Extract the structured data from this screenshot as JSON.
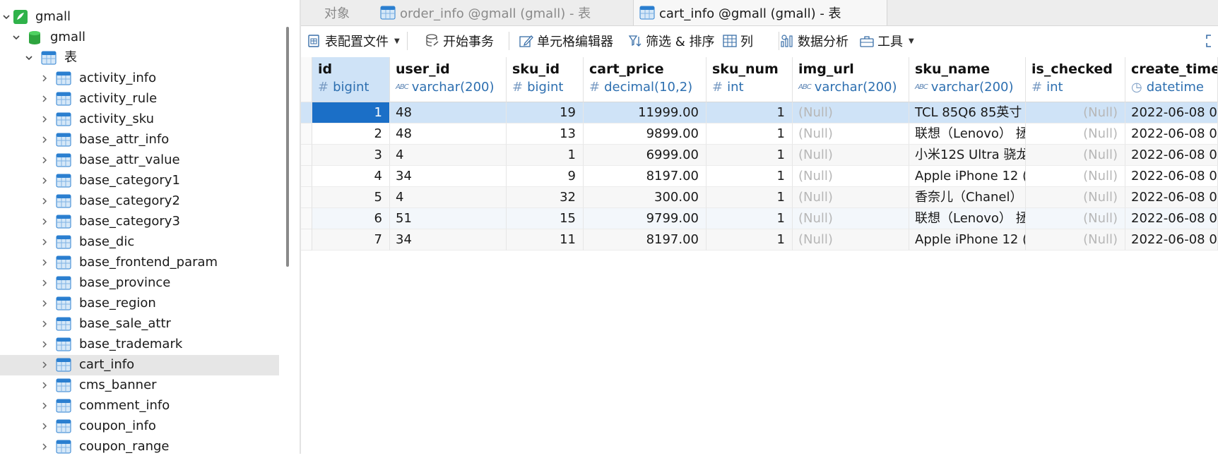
{
  "tree": {
    "root": "gmall",
    "database": "gmall",
    "tables_group": "表",
    "tables": [
      "activity_info",
      "activity_rule",
      "activity_sku",
      "base_attr_info",
      "base_attr_value",
      "base_category1",
      "base_category2",
      "base_category3",
      "base_dic",
      "base_frontend_param",
      "base_province",
      "base_region",
      "base_sale_attr",
      "base_trademark",
      "cart_info",
      "cms_banner",
      "comment_info",
      "coupon_info",
      "coupon_range"
    ],
    "selected_table": "cart_info"
  },
  "tabs": [
    {
      "label": "对象",
      "active": false
    },
    {
      "label": "order_info @gmall (gmall) - 表",
      "active": false
    },
    {
      "label": "cart_info @gmall (gmall) - 表",
      "active": true
    }
  ],
  "toolbar": {
    "table_config": "表配置文件",
    "begin_transaction": "开始事务",
    "cell_editor": "单元格编辑器",
    "filter_sort": "筛选 & 排序",
    "columns": "列",
    "data_analysis": "数据分析",
    "tools": "工具"
  },
  "grid": {
    "columns": [
      {
        "name": "id",
        "type": "bigint",
        "type_icon": "#"
      },
      {
        "name": "user_id",
        "type": "varchar(200)",
        "type_icon": "abc"
      },
      {
        "name": "sku_id",
        "type": "bigint",
        "type_icon": "#"
      },
      {
        "name": "cart_price",
        "type": "decimal(10,2)",
        "type_icon": "#"
      },
      {
        "name": "sku_num",
        "type": "int",
        "type_icon": "#"
      },
      {
        "name": "img_url",
        "type": "varchar(200)",
        "type_icon": "abc"
      },
      {
        "name": "sku_name",
        "type": "varchar(200)",
        "type_icon": "abc"
      },
      {
        "name": "is_checked",
        "type": "int",
        "type_icon": "#"
      },
      {
        "name": "create_time",
        "type": "datetime",
        "type_icon": "clock"
      }
    ],
    "rows": [
      [
        "1",
        "48",
        "19",
        "11999.00",
        "1",
        "(Null)",
        "TCL 85Q6 85英寸",
        "(Null)",
        "2022-06-08 0"
      ],
      [
        "2",
        "48",
        "13",
        "9899.00",
        "1",
        "(Null)",
        "联想（Lenovo） 拯",
        "(Null)",
        "2022-06-08 0"
      ],
      [
        "3",
        "4",
        "1",
        "6999.00",
        "1",
        "(Null)",
        "小米12S Ultra 骁龙",
        "(Null)",
        "2022-06-08 0"
      ],
      [
        "4",
        "34",
        "9",
        "8197.00",
        "1",
        "(Null)",
        "Apple iPhone 12 (",
        "(Null)",
        "2022-06-08 0"
      ],
      [
        "5",
        "4",
        "32",
        "300.00",
        "1",
        "(Null)",
        "香奈儿（Chanel）",
        "(Null)",
        "2022-06-08 0"
      ],
      [
        "6",
        "51",
        "15",
        "9799.00",
        "1",
        "(Null)",
        "联想（Lenovo） 拯",
        "(Null)",
        "2022-06-08 0"
      ],
      [
        "7",
        "34",
        "11",
        "8197.00",
        "1",
        "(Null)",
        "Apple iPhone 12 (",
        "(Null)",
        "2022-06-08 0"
      ]
    ]
  },
  "colors": {
    "selection": "#cfe3f7",
    "focus_cell": "#1b6fc7",
    "type_text": "#2d6fb0",
    "null_text": "#b7b7b7",
    "tree_selected": "#e6e6e6"
  }
}
